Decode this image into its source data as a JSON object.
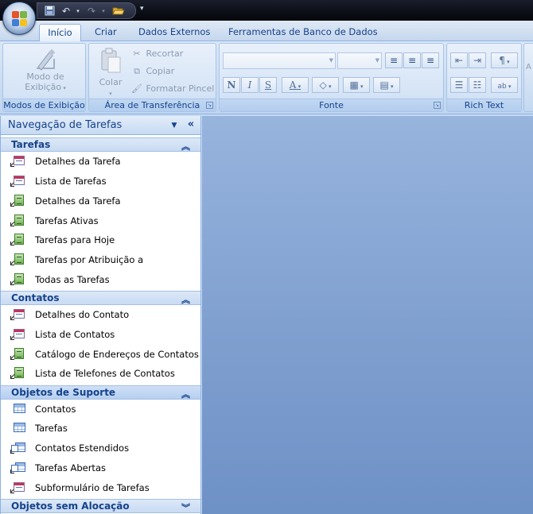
{
  "quick_access": {
    "save": "save-icon",
    "undo": "undo-icon",
    "redo": "redo-icon",
    "open": "open-folder-icon",
    "customize": "customize-qat-icon"
  },
  "tabs": [
    {
      "label": "Início",
      "active": true
    },
    {
      "label": "Criar",
      "active": false
    },
    {
      "label": "Dados Externos",
      "active": false
    },
    {
      "label": "Ferramentas de Banco de Dados",
      "active": false
    }
  ],
  "ribbon": {
    "views": {
      "button_line1": "Modo de",
      "button_line2": "Exibição",
      "group_label": "Modos de Exibição"
    },
    "clipboard": {
      "paste": "Colar",
      "cut": "Recortar",
      "copy": "Copiar",
      "format_painter": "Formatar Pincel",
      "group_label": "Área de Transferência"
    },
    "font": {
      "font_name_value": "",
      "font_size_value": "",
      "bold": "N",
      "italic": "I",
      "underline": "S",
      "font_color": "A",
      "group_label": "Fonte"
    },
    "rich_text": {
      "group_label": "Rich Text"
    }
  },
  "nav_pane": {
    "title": "Navegação de Tarefas",
    "groups": [
      {
        "label": "Tarefas",
        "expanded": true,
        "items": [
          {
            "label": "Detalhes da Tarefa",
            "icon": "form-icon"
          },
          {
            "label": "Lista de Tarefas",
            "icon": "form-icon"
          },
          {
            "label": "Detalhes da Tarefa",
            "icon": "report-icon"
          },
          {
            "label": "Tarefas Ativas",
            "icon": "report-icon"
          },
          {
            "label": "Tarefas para Hoje",
            "icon": "report-icon"
          },
          {
            "label": "Tarefas por Atribuição a",
            "icon": "report-icon"
          },
          {
            "label": "Todas as Tarefas",
            "icon": "report-icon"
          }
        ]
      },
      {
        "label": "Contatos",
        "expanded": true,
        "items": [
          {
            "label": "Detalhes do Contato",
            "icon": "form-icon"
          },
          {
            "label": "Lista de Contatos",
            "icon": "form-icon"
          },
          {
            "label": "Catálogo de Endereços de Contatos",
            "icon": "report-icon"
          },
          {
            "label": "Lista de Telefones de Contatos",
            "icon": "report-icon"
          }
        ]
      },
      {
        "label": "Objetos de Suporte",
        "expanded": true,
        "items": [
          {
            "label": "Contatos",
            "icon": "table-icon"
          },
          {
            "label": "Tarefas",
            "icon": "table-icon"
          },
          {
            "label": "Contatos Estendidos",
            "icon": "query-icon"
          },
          {
            "label": "Tarefas Abertas",
            "icon": "query-icon"
          },
          {
            "label": "Subformulário de Tarefas",
            "icon": "form-icon"
          }
        ]
      },
      {
        "label": "Objetos sem Alocação",
        "expanded": false,
        "items": []
      }
    ]
  },
  "colors": {
    "accent": "#15428b",
    "workspace": "#7f9fcf",
    "ribbon": "#c8dbf1"
  }
}
